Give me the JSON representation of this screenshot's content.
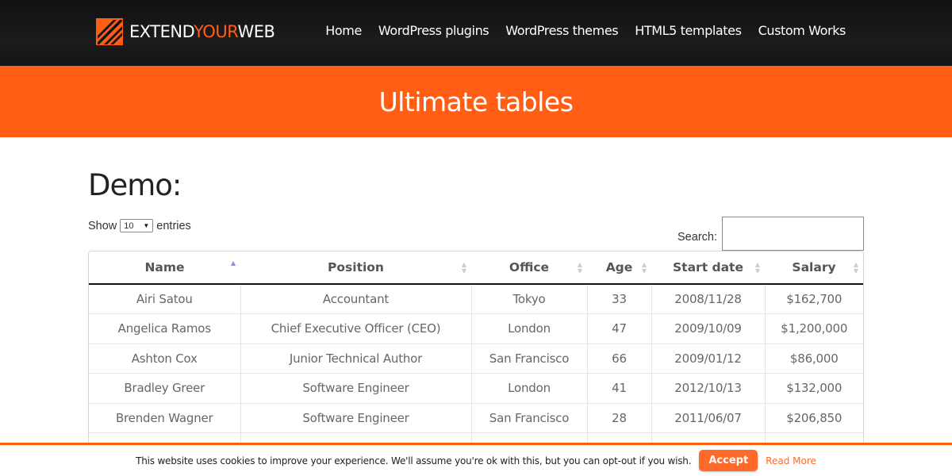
{
  "header": {
    "logo_text_1": "EXTEND",
    "logo_text_2": "YOUR",
    "logo_text_3": "WEB",
    "nav": [
      "Home",
      "WordPress plugins",
      "WordPress themes",
      "HTML5 templates",
      "Custom Works"
    ]
  },
  "banner": {
    "title": "Ultimate tables"
  },
  "demo": {
    "heading": "Demo:",
    "length": {
      "show_label": "Show",
      "value": "10",
      "entries_label": "entries"
    },
    "search": {
      "label": "Search:",
      "value": ""
    }
  },
  "table": {
    "columns": [
      "Name",
      "Position",
      "Office",
      "Age",
      "Start date",
      "Salary"
    ],
    "sorted_column": "Name",
    "rows": [
      [
        "Airi Satou",
        "Accountant",
        "Tokyo",
        "33",
        "2008/11/28",
        "$162,700"
      ],
      [
        "Angelica Ramos",
        "Chief Executive Officer (CEO)",
        "London",
        "47",
        "2009/10/09",
        "$1,200,000"
      ],
      [
        "Ashton Cox",
        "Junior Technical Author",
        "San Francisco",
        "66",
        "2009/01/12",
        "$86,000"
      ],
      [
        "Bradley Greer",
        "Software Engineer",
        "London",
        "41",
        "2012/10/13",
        "$132,000"
      ],
      [
        "Brenden Wagner",
        "Software Engineer",
        "San Francisco",
        "28",
        "2011/06/07",
        "$206,850"
      ]
    ]
  },
  "cookie": {
    "message": "This website uses cookies to improve your experience. We'll assume you're ok with this, but you can opt-out if you wish.",
    "accept_label": "Accept",
    "read_more_label": "Read More"
  },
  "colors": {
    "accent": "#ff5e14",
    "header_bg": "#141414"
  }
}
